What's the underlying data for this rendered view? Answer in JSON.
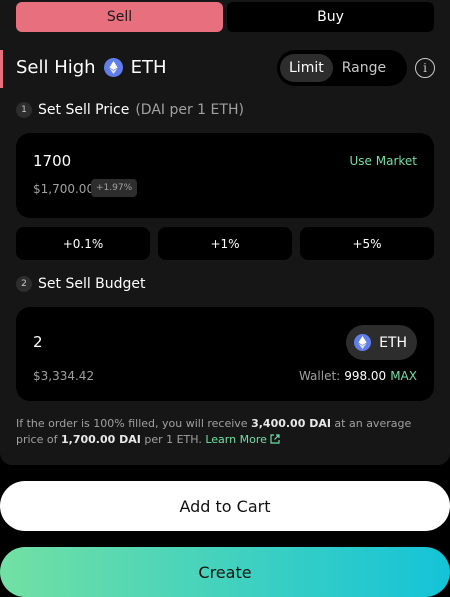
{
  "colors": {
    "sell_accent": "#e8707e",
    "positive": "#6ee0a4",
    "eth": "#627eea",
    "create_gradient_start": "#72e0a3",
    "create_gradient_end": "#14c3d8"
  },
  "side_tabs": {
    "sell": "Sell",
    "buy": "Buy",
    "selected": "Sell"
  },
  "header": {
    "title": "Sell High",
    "token": "ETH",
    "token_icon": "eth-icon",
    "modes": [
      "Limit",
      "Range"
    ],
    "active_mode": "Limit",
    "info_icon": "info-icon"
  },
  "step1": {
    "number": "1",
    "label": "Set Sell Price",
    "sub": "(DAI per 1 ETH)"
  },
  "price": {
    "value": "1700",
    "use_market": "Use Market",
    "usd": "$1,700.00",
    "change_badge": "+1.97%"
  },
  "adjustments": [
    "+0.1%",
    "+1%",
    "+5%"
  ],
  "step2": {
    "number": "2",
    "label": "Set Sell Budget"
  },
  "budget": {
    "value": "2",
    "token": "ETH",
    "usd": "$3,334.42",
    "wallet_label": "Wallet:",
    "wallet_value": "998.00",
    "max": "MAX"
  },
  "summary": {
    "part1": "If the order is 100% filled, you will receive ",
    "receive_amount": "3,400.00 DAI",
    "part2": " at an average price of ",
    "avg_price": "1,700.00 DAI",
    "part3": " per 1 ETH. ",
    "learn_more": "Learn More",
    "learn_more_icon": "external-link-icon"
  },
  "actions": {
    "add_to_cart": "Add to Cart",
    "create": "Create"
  }
}
